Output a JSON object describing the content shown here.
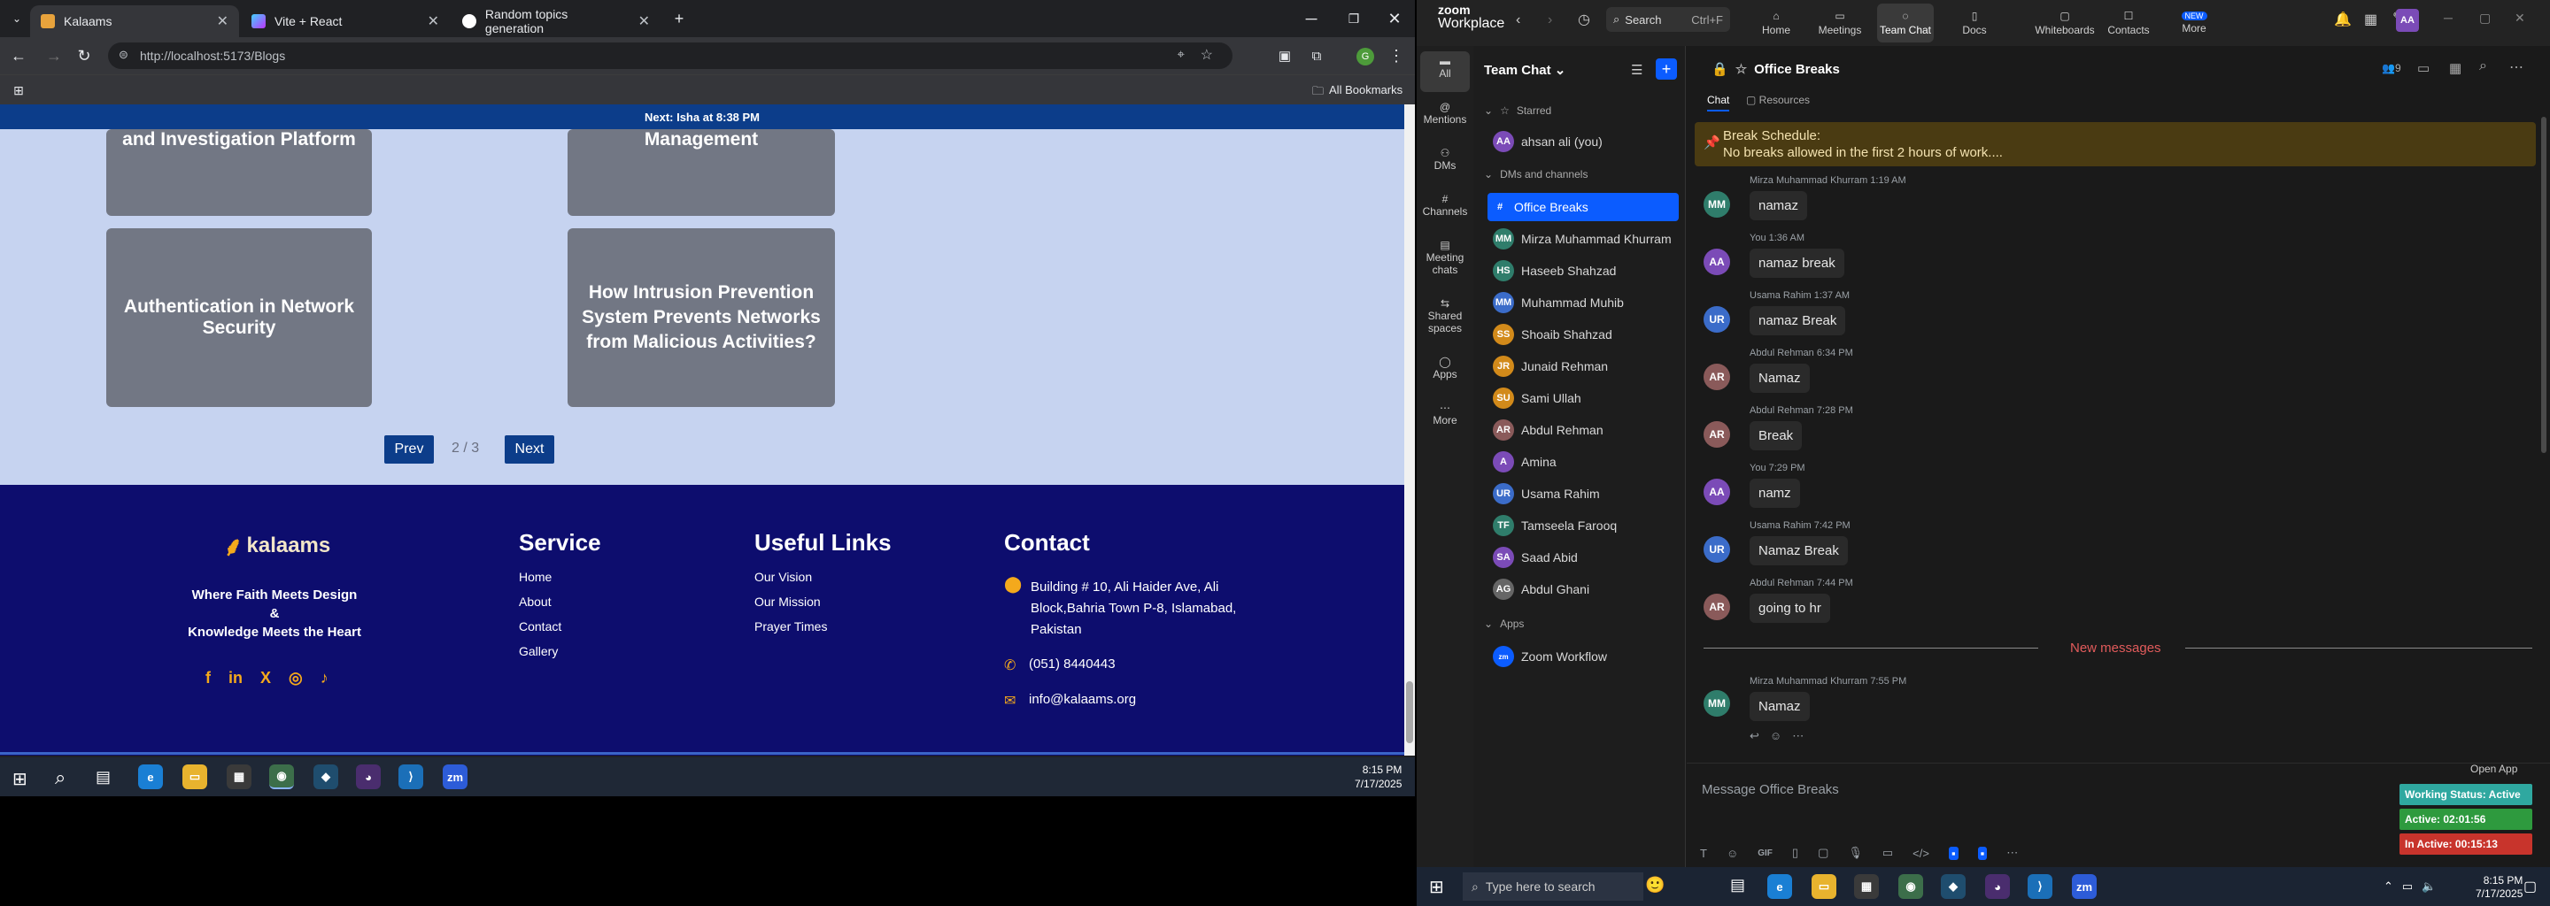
{
  "browser": {
    "tabs": [
      {
        "label": "Kalaams",
        "icon": "kalaams-favicon"
      },
      {
        "label": "Vite + React",
        "icon": "vite-favicon"
      },
      {
        "label": "Random topics generation",
        "icon": "chatgpt-favicon"
      }
    ],
    "url": "http://localhost:5173/Blogs",
    "all_bookmarks": "All Bookmarks"
  },
  "site": {
    "announcement": "Next: Isha at 8:38 PM",
    "cards": [
      "and Investigation Platform",
      "Management",
      "Authentication in Network Security",
      "How Intrusion Prevention System Prevents Networks from Malicious Activities?"
    ],
    "pagination": {
      "prev": "Prev",
      "page": "2 / 3",
      "next": "Next"
    },
    "footer": {
      "logo": "kalaams",
      "tagline1": "Where Faith Meets Design",
      "tagline_amp": "&",
      "tagline2": "Knowledge Meets the Heart",
      "service_heading": "Service",
      "service_links": [
        "Home",
        "About",
        "Contact",
        "Gallery"
      ],
      "useful_heading": "Useful Links",
      "useful_links": [
        "Our Vision",
        "Our Mission",
        "Prayer Times"
      ],
      "contact_heading": "Contact",
      "address": "Building # 10, Ali Haider Ave, Ali Block,Bahria Town P-8, Islamabad, Pakistan",
      "phone": "(051) 8440443",
      "email": "info@kalaams.org",
      "social": [
        "f",
        "in",
        "X",
        "◎",
        "♪"
      ]
    }
  },
  "taskbar_left": {
    "time": "8:15 PM",
    "date": "7/17/2025"
  },
  "zoom": {
    "brand_line1": "zoom",
    "brand_line2": "Workplace",
    "search": "Search",
    "search_shortcut": "Ctrl+F",
    "nav": [
      "Home",
      "Meetings",
      "Team Chat",
      "Docs",
      "Whiteboards",
      "Contacts",
      "More"
    ],
    "new_badge": "NEW",
    "avatar": "AA",
    "rail": [
      "All",
      "Mentions",
      "DMs",
      "Channels",
      "Meeting chats",
      "Shared spaces",
      "Apps",
      "More"
    ],
    "panel_title": "Team Chat",
    "starred_label": "Starred",
    "starred": [
      {
        "initials": "AA",
        "name": "ahsan ali (you)",
        "color": "#7b4bb7"
      }
    ],
    "dms_label": "DMs and channels",
    "dms": [
      {
        "initials": "#",
        "name": "Office Breaks",
        "color": "#0b5cff",
        "selected": true
      },
      {
        "initials": "MM",
        "name": "Mirza Muhammad Khurram",
        "color": "#2f7d6b"
      },
      {
        "initials": "HS",
        "name": "Haseeb Shahzad",
        "color": "#2f7d6b"
      },
      {
        "initials": "MM",
        "name": "Muhammad Muhib",
        "color": "#3b6cc9"
      },
      {
        "initials": "SS",
        "name": "Shoaib Shahzad",
        "color": "#d28a1a"
      },
      {
        "initials": "JR",
        "name": "Junaid Rehman",
        "color": "#d28a1a"
      },
      {
        "initials": "SU",
        "name": "Sami Ullah",
        "color": "#d28a1a"
      },
      {
        "initials": "AR",
        "name": "Abdul Rehman",
        "color": "#8a5a5a"
      },
      {
        "initials": "A",
        "name": "Amina",
        "color": "#7b4bb7"
      },
      {
        "initials": "UR",
        "name": "Usama Rahim",
        "color": "#3b6cc9"
      },
      {
        "initials": "TF",
        "name": "Tamseela Farooq",
        "color": "#2f7d6b"
      },
      {
        "initials": "SA",
        "name": "Saad Abid",
        "color": "#7b4bb7"
      },
      {
        "initials": "AG",
        "name": "Abdul Ghani",
        "color": "#666666"
      }
    ],
    "apps_label": "Apps",
    "apps": [
      {
        "name": "Zoom Workflow"
      }
    ],
    "channel_title": "Office Breaks",
    "chat_tab": "Chat",
    "resources_tab": "Resources",
    "member_count": "9",
    "pinned_title": "Break Schedule:",
    "pinned_body": "No breaks allowed in the first 2 hours of work....",
    "messages": [
      {
        "initials": "MM",
        "color": "#2f7d6b",
        "meta": "Mirza Muhammad Khurram 1:19 AM",
        "text": "namaz"
      },
      {
        "initials": "AA",
        "color": "#7b4bb7",
        "meta": "You 1:36 AM",
        "text": "namaz break"
      },
      {
        "initials": "UR",
        "color": "#3b6cc9",
        "meta": "Usama Rahim 1:37 AM",
        "text": "namaz Break"
      },
      {
        "initials": "AR",
        "color": "#8a5a5a",
        "meta": "Abdul Rehman 6:34 PM",
        "text": "Namaz"
      },
      {
        "initials": "AR",
        "color": "#8a5a5a",
        "meta": "Abdul Rehman 7:28 PM",
        "text": "Break"
      },
      {
        "initials": "AA",
        "color": "#7b4bb7",
        "meta": "You 7:29 PM",
        "text": "namz"
      },
      {
        "initials": "UR",
        "color": "#3b6cc9",
        "meta": "Usama Rahim 7:42 PM",
        "text": "Namaz Break"
      },
      {
        "initials": "AR",
        "color": "#8a5a5a",
        "meta": "Abdul Rehman 7:44 PM",
        "text": "going to hr"
      }
    ],
    "new_messages": "New messages",
    "last_message": {
      "initials": "MM",
      "color": "#2f7d6b",
      "meta": "Mirza Muhammad Khurram 7:55 PM",
      "text": "Namaz"
    },
    "composer_placeholder": "Message Office Breaks",
    "open_app": "Open App",
    "status": [
      {
        "text": "Working Status: Active",
        "color": "#2fa8a0"
      },
      {
        "text": "Active: 02:01:56",
        "color": "#2e9a3e"
      },
      {
        "text": "In Active: 00:15:13",
        "color": "#c8342c"
      }
    ]
  },
  "taskbar_right": {
    "search_placeholder": "Type here to search",
    "time": "8:15 PM",
    "date": "7/17/2025"
  }
}
